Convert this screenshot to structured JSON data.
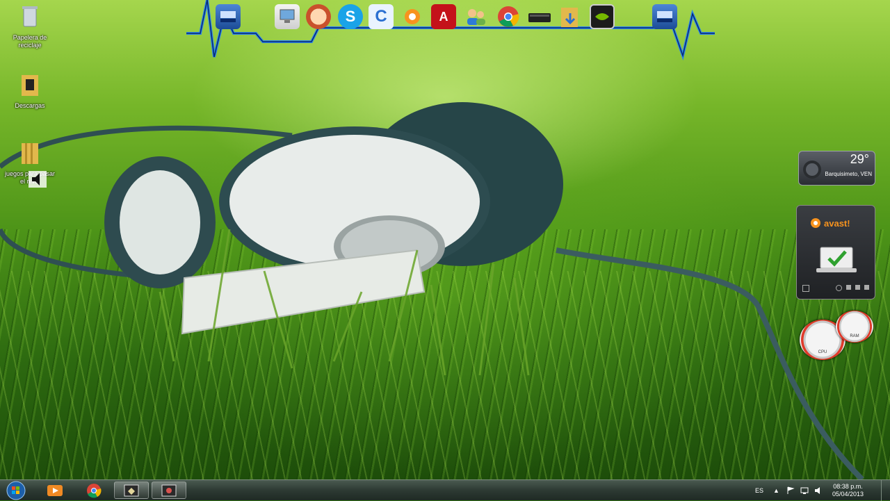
{
  "desktop": {
    "icons": [
      {
        "label": "Papelera de reciclaje",
        "icon": "recycle-bin-icon"
      },
      {
        "label": "Descargas",
        "icon": "folder-icon"
      },
      {
        "label": "juegos para pasar el nivel",
        "icon": "folder-icon"
      }
    ]
  },
  "dock": {
    "icons": [
      "network-icon",
      "computer-icon",
      "avatar-icon",
      "skype-icon",
      "ccleaner-icon",
      "avast-icon",
      "acrobat-icon",
      "users-icon",
      "chrome-icon",
      "drive-icon",
      "folder-download-icon",
      "nvidia-icon",
      "network-icon"
    ]
  },
  "weather": {
    "temperature": "29°",
    "location": "Barquisimeto, VEN"
  },
  "avast_gadget": {
    "brand": "avast!"
  },
  "meters": {
    "cpu_label": "CPU",
    "ram_label": "RAM"
  },
  "taskbar": {
    "language": "ES",
    "time": "08:38 p.m.",
    "date": "05/04/2013"
  },
  "colors": {
    "dock_line": "#1e7bff",
    "accent": "#3aa0ff"
  }
}
